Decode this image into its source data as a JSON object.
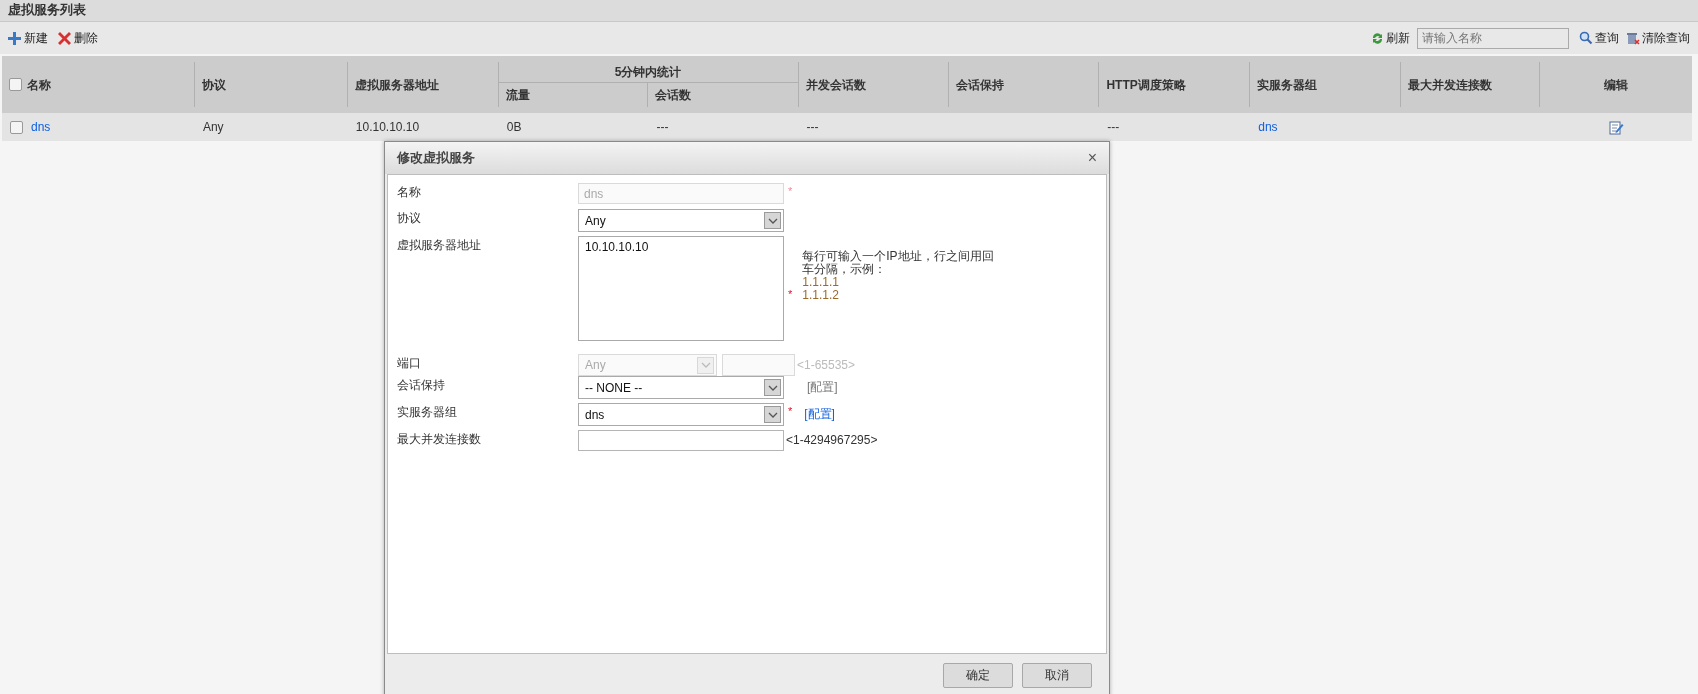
{
  "page_title": "虚拟服务列表",
  "toolbar": {
    "actions": [
      {
        "kind": "add",
        "label": "新建"
      },
      {
        "kind": "delete",
        "label": "删除"
      }
    ],
    "refresh": "刷新",
    "search": {
      "placeholder": "请输入名称"
    },
    "query": "查询",
    "clear": "清除查询"
  },
  "table": {
    "select_all_checked": false,
    "group_header": "5分钟内统计",
    "columns": [
      "名称",
      "协议",
      "虚拟服务器地址",
      "流量",
      "会话数",
      "并发会话数",
      "会话保持",
      "HTTP调度策略",
      "实服务器组",
      "最大并发连接数",
      "编辑"
    ],
    "rows": [
      {
        "checked": false,
        "cells": [
          {
            "kind": "link",
            "text": "dns"
          },
          {
            "kind": "text",
            "text": "Any"
          },
          {
            "kind": "text",
            "text": "10.10.10.10"
          },
          {
            "kind": "text",
            "text": "0B"
          },
          {
            "kind": "text",
            "text": "---"
          },
          {
            "kind": "text",
            "text": "---"
          },
          {
            "kind": "empty"
          },
          {
            "kind": "text",
            "text": "---"
          },
          {
            "kind": "link",
            "text": "dns"
          },
          {
            "kind": "empty"
          },
          {
            "kind": "edit"
          }
        ]
      }
    ]
  },
  "dialog": {
    "title": "修改虚拟服务",
    "close": "×",
    "fields": [
      {
        "kind": "text",
        "label": "名称",
        "value": "dns",
        "disabled": true,
        "mark": "*"
      },
      {
        "kind": "select",
        "label": "协议",
        "value": "Any"
      },
      {
        "kind": "textarea",
        "label": "虚拟服务器地址",
        "value": "10.10.10.10",
        "mark": "*",
        "hint": "每行可输入一个IP地址，行之间用回车分隔，示例：",
        "examples": [
          "1.1.1.1",
          "1.1.1.2"
        ]
      },
      {
        "kind": "port",
        "label": "端口",
        "value": "Any",
        "disabled": true,
        "range": "<1-65535>"
      },
      {
        "kind": "select",
        "label": "会话保持",
        "value": "-- NONE --",
        "link": {
          "text": "[配置]",
          "disabled": true
        }
      },
      {
        "kind": "select",
        "label": "实服务器组",
        "value": "dns",
        "mark": "*",
        "link": {
          "text": "[配置]",
          "disabled": false
        }
      },
      {
        "kind": "text",
        "label": "最大并发连接数",
        "disabled": false,
        "range": "<1-4294967295>"
      }
    ],
    "buttons": [
      "确定",
      "取消"
    ]
  }
}
